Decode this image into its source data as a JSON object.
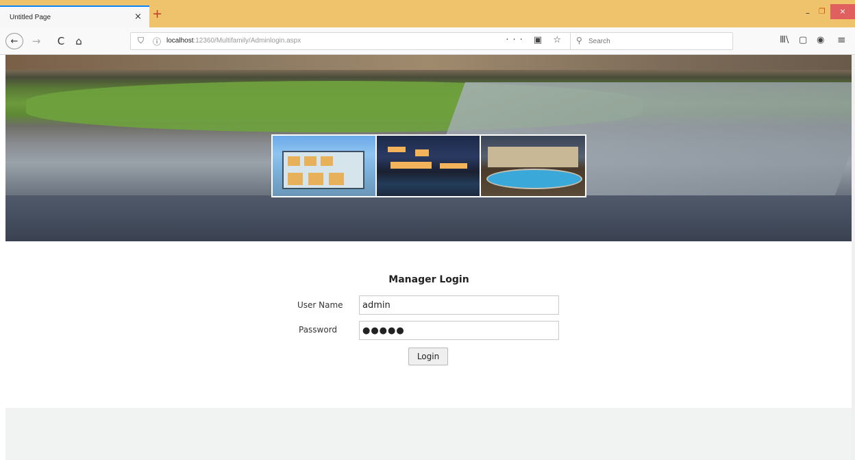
{
  "browser": {
    "tab_title": "Untitled Page",
    "tab_close": "×",
    "new_tab": "+",
    "window": {
      "minimize": "–",
      "maximize": "❐",
      "close": "×"
    },
    "nav": {
      "back": "←",
      "forward": "→",
      "reload": "C",
      "home": "⌂"
    },
    "url": {
      "host": "localhost",
      "path": ":12360/Multifamily/Adminlogin.aspx",
      "actions": "··· ▣ ☆"
    },
    "search": {
      "placeholder": "Search",
      "icon": "🔍"
    },
    "toolbar": {
      "library": "Ⅲ\\",
      "sidebar": "▢",
      "account": "◉",
      "menu": "≡"
    }
  },
  "banner": {
    "images": [
      "modern-glass-house",
      "house-with-pool-at-dusk",
      "villa-with-swimming-pool"
    ]
  },
  "login": {
    "title": "Manager Login",
    "username_label": "User Name",
    "username_value": "admin",
    "password_label": "Password",
    "password_value": "●●●●●",
    "button_label": "Login"
  }
}
